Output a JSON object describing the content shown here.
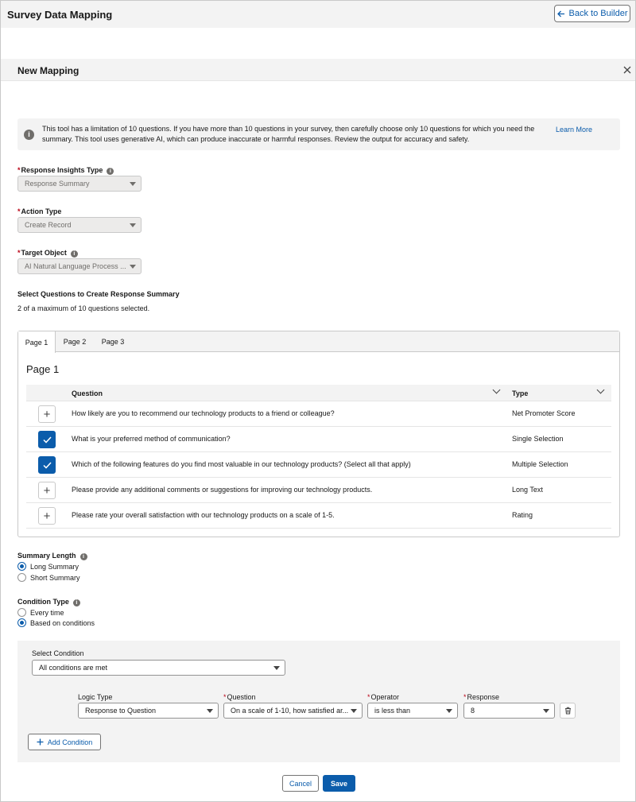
{
  "app": {
    "title": "Survey Data Mapping",
    "back_label": "Back to Builder"
  },
  "modal": {
    "title": "New Mapping"
  },
  "info": {
    "text": "This tool has a limitation of 10 questions. If you have more than 10 questions in your survey, then carefully choose only 10 questions for which you need the summary. This tool uses generative AI, which can produce inaccurate or harmful responses. Review the output for accuracy and safety.",
    "link": "Learn More"
  },
  "fields": {
    "insights_type": {
      "label": "Response Insights Type",
      "value": "Response Summary"
    },
    "action_type": {
      "label": "Action Type",
      "value": "Create Record"
    },
    "target_object": {
      "label": "Target Object",
      "value": "AI Natural Language Process ..."
    }
  },
  "questions_section": {
    "title": "Select Questions to Create Response Summary",
    "selected_text": "2 of a maximum of 10 questions selected.",
    "tabs": [
      "Page 1",
      "Page 2",
      "Page 3"
    ],
    "page_heading": "Page 1",
    "columns": {
      "question": "Question",
      "type": "Type"
    },
    "rows": [
      {
        "question": "How likely are you to recommend our technology products to a friend or colleague?",
        "type": "Net Promoter Score",
        "selected": false
      },
      {
        "question": "What is your preferred method of communication?",
        "type": "Single Selection",
        "selected": true
      },
      {
        "question": "Which of the following features do you find most valuable in our technology products? (Select all that apply)",
        "type": "Multiple Selection",
        "selected": true
      },
      {
        "question": "Please provide any additional comments or suggestions for improving our technology products.",
        "type": "Long Text",
        "selected": false
      },
      {
        "question": "Please rate your overall satisfaction with our technology products on a scale of 1-5.",
        "type": "Rating",
        "selected": false
      }
    ]
  },
  "summary_length": {
    "label": "Summary Length",
    "options": [
      "Long Summary",
      "Short Summary"
    ],
    "selected": "Long Summary"
  },
  "condition_type": {
    "label": "Condition Type",
    "options": [
      "Every time",
      "Based on conditions"
    ],
    "selected": "Based on conditions"
  },
  "conditions": {
    "select_label": "Select Condition",
    "select_value": "All conditions are met",
    "logic_type": {
      "label": "Logic Type",
      "value": "Response to Question"
    },
    "question": {
      "label": "Question",
      "value": "On a scale of 1-10, how satisfied ar..."
    },
    "operator": {
      "label": "Operator",
      "value": "is less than"
    },
    "response": {
      "label": "Response",
      "value": "8"
    },
    "add_label": "Add Condition"
  },
  "footer": {
    "cancel": "Cancel",
    "save": "Save"
  },
  "colors": {
    "brand": "#0b5cab",
    "required": "#ba0517",
    "panel": "#f3f3f3"
  }
}
